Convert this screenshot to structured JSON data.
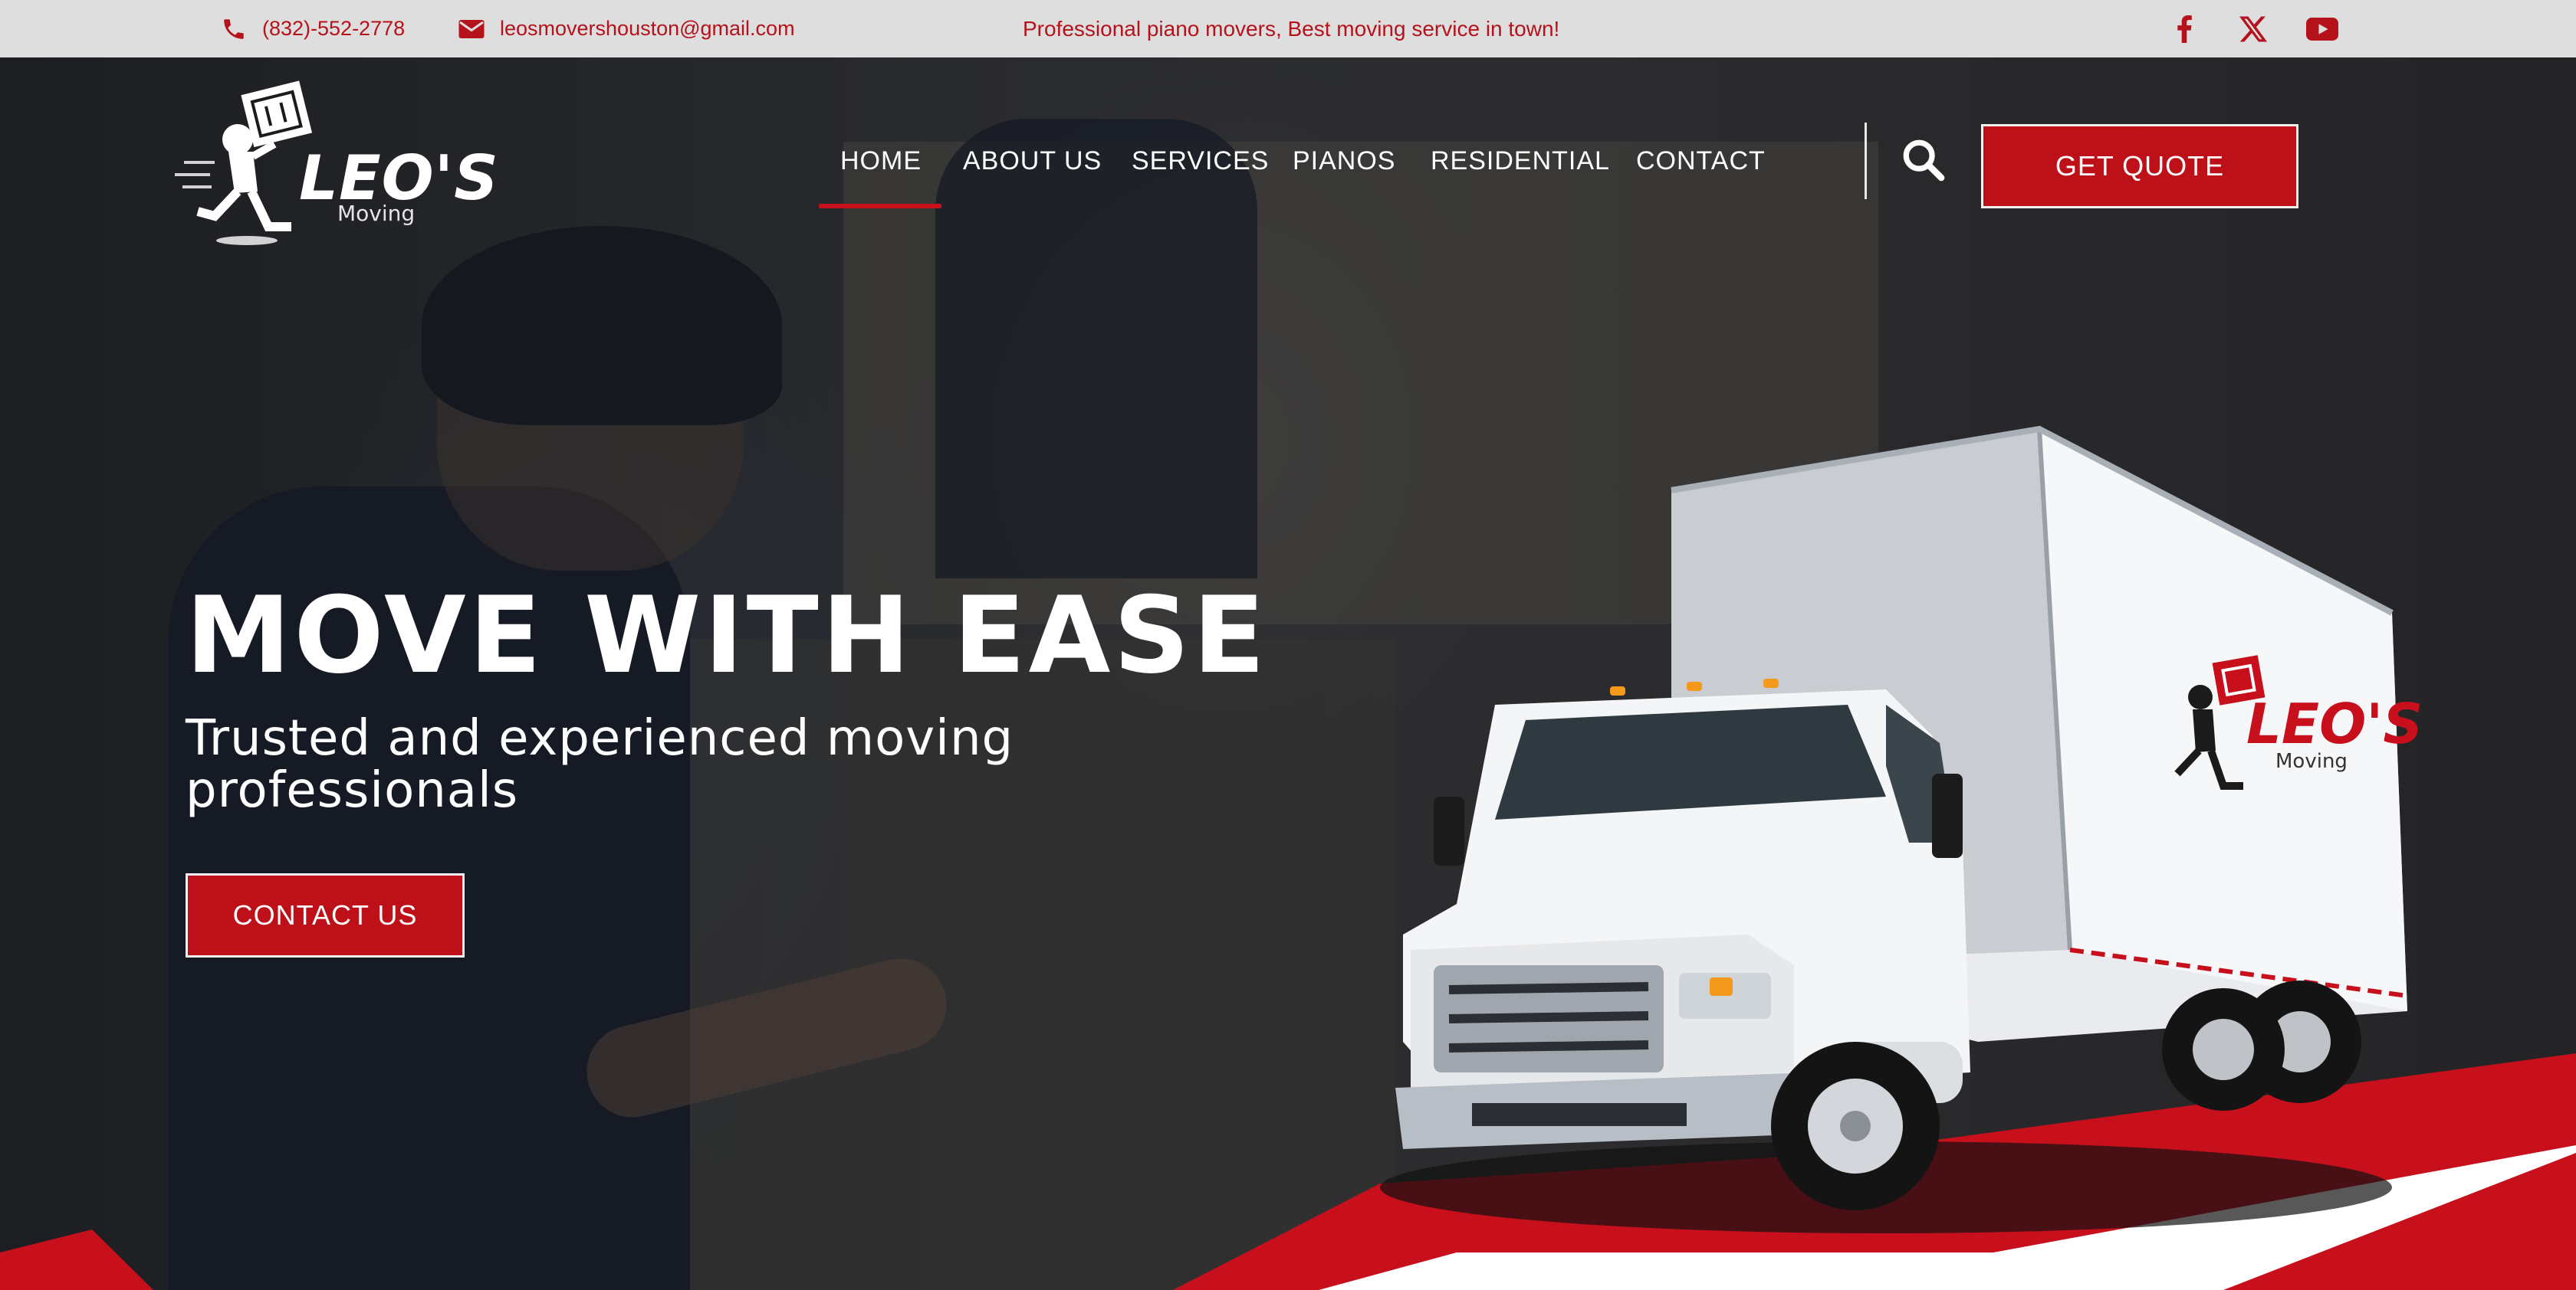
{
  "topbar": {
    "phone": "(832)-552-2778",
    "email": "leosmovershouston@gmail.com",
    "tagline": "Professional piano movers, Best moving service in town!",
    "social_icons": [
      "facebook-icon",
      "x-icon",
      "youtube-icon"
    ]
  },
  "brand": {
    "name": "LEO'S",
    "sub": "Moving"
  },
  "nav": {
    "items": [
      "HOME",
      "ABOUT US",
      "SERVICES",
      "PIANOS",
      "RESIDENTIAL",
      "CONTACT"
    ],
    "active": "HOME",
    "quote_label": "GET QUOTE"
  },
  "hero": {
    "title": "MOVE WITH EASE",
    "subtitle": "Trusted and experienced moving professionals",
    "cta_label": "CONTACT US"
  },
  "truck": {
    "brand": "LEO'S",
    "sub": "Moving"
  },
  "colors": {
    "accent": "#bd1018",
    "topbar_bg": "#dedede",
    "text_light": "#ffffff"
  }
}
